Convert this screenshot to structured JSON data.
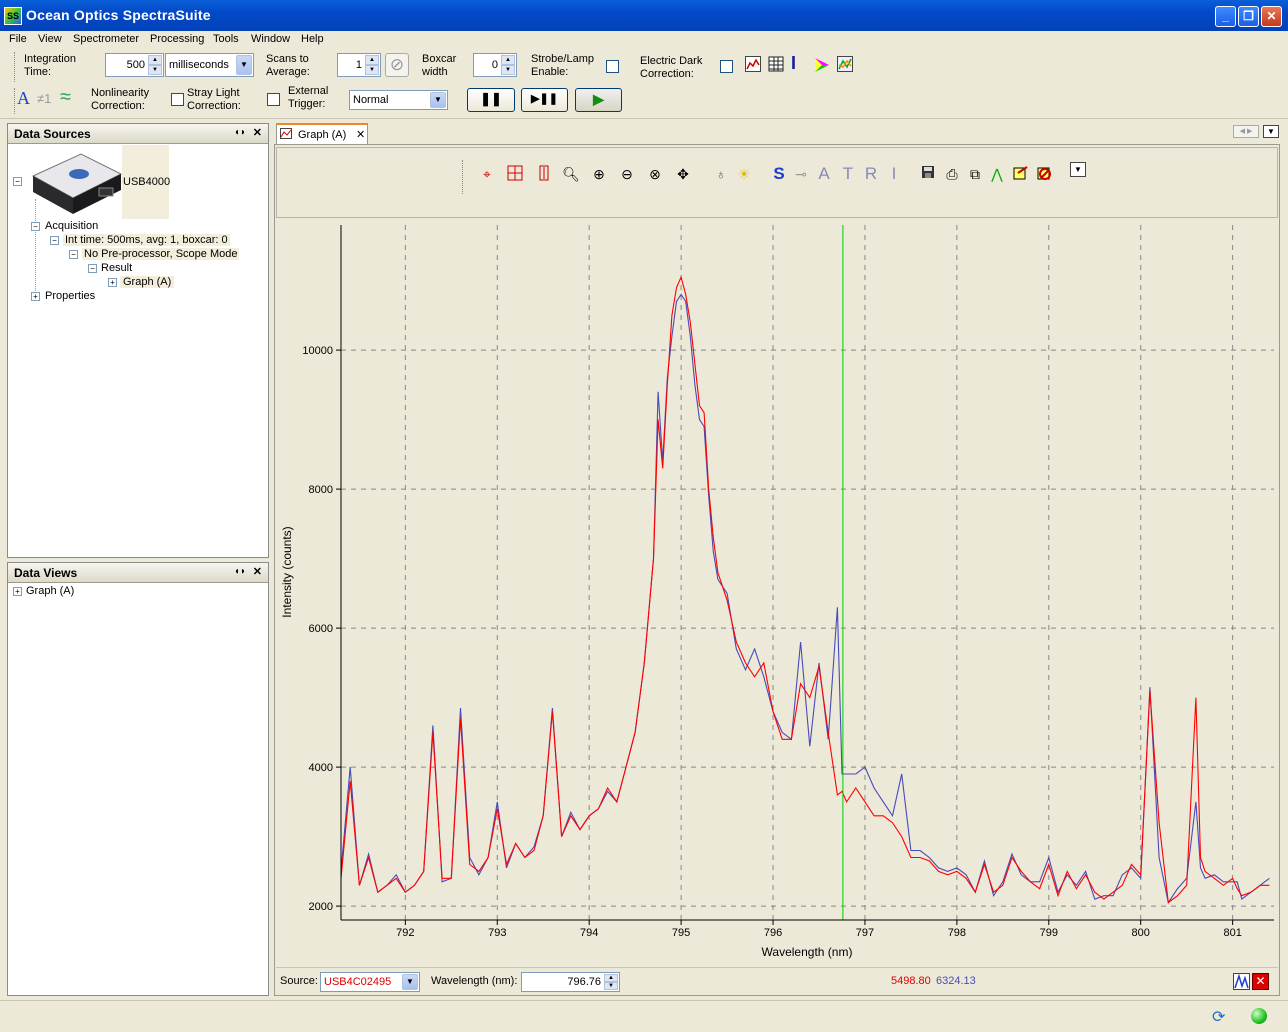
{
  "window": {
    "title": "Ocean Optics SpectraSuite",
    "icon": "SS"
  },
  "menu": [
    "File",
    "View",
    "Spectrometer",
    "Processing",
    "Tools",
    "Window",
    "Help"
  ],
  "toolbar": {
    "integration_label_1": "Integration",
    "integration_label_2": "Time:",
    "integration_value": "500",
    "integration_unit": "milliseconds",
    "scans_label_1": "Scans to",
    "scans_label_2": "Average:",
    "scans_value": "1",
    "boxcar_label_1": "Boxcar",
    "boxcar_label_2": "width",
    "boxcar_value": "0",
    "strobe_label_1": "Strobe/Lamp",
    "strobe_label_2": "Enable:",
    "dark_label_1": "Electric Dark",
    "dark_label_2": "Correction:",
    "nonlin_label_1": "Nonlinearity",
    "nonlin_label_2": "Correction:",
    "stray_label_1": "Stray Light",
    "stray_label_2": "Correction:",
    "ext_label_1": "External",
    "ext_label_2": "Trigger:",
    "trigger_mode": "Normal",
    "glyph_a": "A",
    "glyph_neq": "≠1",
    "glyph_wave": "≈"
  },
  "data_sources": {
    "header": "Data Sources",
    "device": "USB4000",
    "acquisition": "Acquisition",
    "int_time": "Int time: 500ms, avg: 1, boxcar: 0",
    "preproc": "No Pre-processor, Scope Mode",
    "result": "Result",
    "graph": "Graph (A)",
    "properties": "Properties"
  },
  "data_views": {
    "header": "Data Views",
    "graph": "Graph (A)"
  },
  "tab": {
    "label": "Graph (A)"
  },
  "graph_tools": {
    "letters": [
      "S",
      "A",
      "T",
      "R",
      "I"
    ]
  },
  "colors": {
    "series1": "#ff0000",
    "series2": "#4a4ab8",
    "cursor": "#00cc00"
  },
  "chart_data": {
    "type": "line",
    "xlabel": "Wavelength (nm)",
    "ylabel": "Intensity (counts)",
    "xlim": [
      791.3,
      801.45
    ],
    "ylim": [
      1800,
      11800
    ],
    "xticks": [
      792,
      793,
      794,
      795,
      796,
      797,
      798,
      799,
      800,
      801
    ],
    "yticks": [
      2000,
      4000,
      6000,
      8000,
      10000
    ],
    "grid": true,
    "cursor_x": 796.76,
    "series": [
      {
        "color": "#ff0000",
        "x": [
          791.3,
          791.4,
          791.5,
          791.6,
          791.7,
          791.8,
          791.9,
          792.0,
          792.1,
          792.2,
          792.3,
          792.4,
          792.5,
          792.6,
          792.7,
          792.8,
          792.9,
          793.0,
          793.1,
          793.2,
          793.3,
          793.4,
          793.5,
          793.6,
          793.7,
          793.8,
          793.9,
          794.0,
          794.1,
          794.2,
          794.3,
          794.4,
          794.5,
          794.6,
          794.7,
          794.75,
          794.8,
          794.85,
          794.9,
          794.95,
          795.0,
          795.05,
          795.1,
          795.15,
          795.2,
          795.25,
          795.3,
          795.35,
          795.4,
          795.5,
          795.6,
          795.7,
          795.8,
          795.9,
          796.0,
          796.1,
          796.2,
          796.3,
          796.4,
          796.5,
          796.6,
          796.7,
          796.75,
          796.8,
          796.9,
          797.0,
          797.1,
          797.2,
          797.3,
          797.4,
          797.5,
          797.6,
          797.7,
          797.8,
          797.9,
          798.0,
          798.1,
          798.2,
          798.3,
          798.4,
          798.5,
          798.6,
          798.7,
          798.8,
          798.9,
          799.0,
          799.1,
          799.2,
          799.3,
          799.4,
          799.5,
          799.6,
          799.7,
          799.8,
          799.9,
          800.0,
          800.1,
          800.2,
          800.3,
          800.4,
          800.5,
          800.6,
          800.65,
          800.7,
          800.8,
          800.9,
          801.0,
          801.05,
          801.1,
          801.2,
          801.3,
          801.4
        ],
        "y": [
          2400,
          3800,
          2300,
          2700,
          2200,
          2300,
          2400,
          2200,
          2300,
          2500,
          4500,
          2400,
          2400,
          4700,
          2600,
          2500,
          2700,
          3400,
          2600,
          2900,
          2700,
          2800,
          3300,
          4800,
          3000,
          3300,
          3100,
          3300,
          3400,
          3700,
          3500,
          4000,
          4500,
          5500,
          7000,
          9000,
          8300,
          9500,
          10500,
          10900,
          11050,
          10800,
          10400,
          9800,
          9200,
          9100,
          8000,
          7300,
          6800,
          6400,
          5800,
          5500,
          5300,
          5500,
          4800,
          4400,
          4400,
          5200,
          5000,
          5450,
          4500,
          3600,
          3650,
          3500,
          3700,
          3500,
          3300,
          3300,
          3200,
          3000,
          2700,
          2700,
          2650,
          2500,
          2450,
          2500,
          2400,
          2200,
          2600,
          2200,
          2300,
          2700,
          2500,
          2350,
          2250,
          2600,
          2150,
          2500,
          2250,
          2450,
          2200,
          2100,
          2200,
          2300,
          2600,
          2450,
          5100,
          3200,
          2050,
          2150,
          2300,
          5000,
          2700,
          2500,
          2400,
          2300,
          2400,
          2250,
          2150,
          2200,
          2300,
          2300
        ]
      },
      {
        "color": "#4a4ab8",
        "x": [
          791.3,
          791.4,
          791.5,
          791.6,
          791.7,
          791.8,
          791.9,
          792.0,
          792.1,
          792.2,
          792.3,
          792.4,
          792.5,
          792.6,
          792.7,
          792.8,
          792.9,
          793.0,
          793.1,
          793.2,
          793.3,
          793.4,
          793.5,
          793.6,
          793.7,
          793.8,
          793.9,
          794.0,
          794.1,
          794.2,
          794.3,
          794.4,
          794.5,
          794.6,
          794.7,
          794.75,
          794.8,
          794.85,
          794.9,
          794.95,
          795.0,
          795.05,
          795.1,
          795.15,
          795.2,
          795.25,
          795.3,
          795.35,
          795.4,
          795.5,
          795.6,
          795.7,
          795.8,
          795.9,
          796.0,
          796.1,
          796.2,
          796.3,
          796.4,
          796.5,
          796.6,
          796.7,
          796.75,
          796.8,
          796.9,
          797.0,
          797.1,
          797.2,
          797.3,
          797.4,
          797.5,
          797.6,
          797.7,
          797.8,
          797.9,
          798.0,
          798.1,
          798.2,
          798.3,
          798.4,
          798.5,
          798.6,
          798.7,
          798.8,
          798.9,
          799.0,
          799.1,
          799.2,
          799.3,
          799.4,
          799.5,
          799.6,
          799.7,
          799.8,
          799.9,
          800.0,
          800.1,
          800.2,
          800.3,
          800.4,
          800.5,
          800.6,
          800.65,
          800.7,
          800.8,
          800.9,
          801.0,
          801.05,
          801.1,
          801.2,
          801.3,
          801.4
        ],
        "y": [
          2500,
          4000,
          2300,
          2750,
          2200,
          2300,
          2450,
          2200,
          2300,
          2500,
          4600,
          2350,
          2400,
          4850,
          2700,
          2450,
          2700,
          3500,
          2550,
          2900,
          2700,
          2850,
          3300,
          4850,
          3000,
          3350,
          3100,
          3300,
          3400,
          3650,
          3500,
          4000,
          4500,
          5500,
          7000,
          9400,
          8400,
          9600,
          10200,
          10700,
          10800,
          10700,
          10200,
          9500,
          9000,
          8900,
          7900,
          7100,
          6700,
          6500,
          5700,
          5400,
          5700,
          5300,
          4800,
          4500,
          4400,
          5800,
          4300,
          5500,
          4400,
          6300,
          3900,
          3900,
          3900,
          4000,
          3700,
          3500,
          3300,
          3900,
          2800,
          2800,
          2700,
          2550,
          2500,
          2550,
          2450,
          2200,
          2650,
          2150,
          2350,
          2750,
          2450,
          2350,
          2350,
          2700,
          2200,
          2450,
          2300,
          2500,
          2100,
          2150,
          2150,
          2450,
          2550,
          2400,
          5150,
          2700,
          2050,
          2250,
          2400,
          3500,
          2550,
          2400,
          2450,
          2350,
          2350,
          2350,
          2100,
          2200,
          2300,
          2400
        ]
      }
    ]
  },
  "source_bar": {
    "source_label": "Source:",
    "source_value": "USB4C02495",
    "wavelength_label": "Wavelength (nm):",
    "wavelength_value": "796.76",
    "readout_red": "5498.80",
    "readout_blue": "6324.13"
  }
}
